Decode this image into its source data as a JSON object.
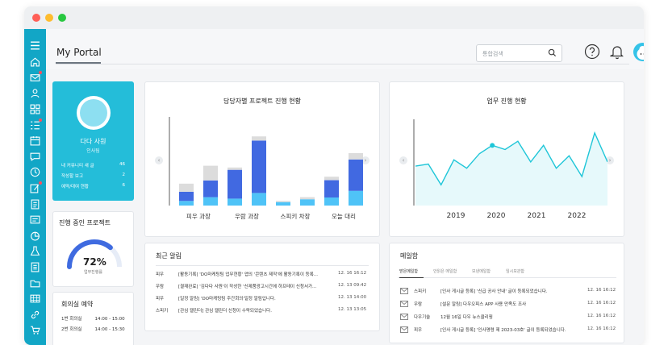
{
  "header": {
    "title": "My Portal",
    "search_placeholder": "통합검색"
  },
  "profile": {
    "name": "다다 사원",
    "role": "인사팀",
    "stats": [
      {
        "label": "내 커뮤니티 새 글",
        "value": "46"
      },
      {
        "label": "작성할 보고",
        "value": "2"
      },
      {
        "label": "예약/대여 현황",
        "value": "6"
      }
    ]
  },
  "project_progress": {
    "title": "진행 중인 프로젝트",
    "percent": "72%",
    "sub": "업무진행률",
    "value": 0.72
  },
  "meeting": {
    "title": "회의실 예약",
    "rows": [
      {
        "room": "1번 회의실",
        "time": "14:00 - 15:00"
      },
      {
        "room": "2번 회의실",
        "time": "14:00 - 15:30"
      }
    ]
  },
  "chart_left": {
    "title": "담당자별 프로젝트 진행 현황"
  },
  "chart_right": {
    "title": "업무 진행 현황"
  },
  "chart_data": [
    {
      "type": "bar",
      "categories": [
        "피우 과장",
        "우람 과장",
        "스피키 차장",
        "오늘 대리"
      ],
      "series": [
        {
          "values": [
            4,
            6,
            3,
            7
          ]
        },
        {
          "values": [
            8,
            25,
            0,
            15
          ]
        },
        {
          "values": [
            7,
            2,
            1,
            3
          ]
        }
      ],
      "bars_per_category": 2,
      "colors": [
        "#4fc3f7",
        "#4169e1",
        "#dcdcdc"
      ]
    },
    {
      "type": "area",
      "x_ticks": [
        "2019",
        "2020",
        "2021",
        "2022"
      ],
      "values": [
        38,
        40,
        20,
        44,
        36,
        50,
        58,
        54,
        62,
        42,
        58,
        36,
        48,
        28,
        70,
        42
      ],
      "color": "#1fc6d8"
    }
  ],
  "alerts": {
    "title": "최근 알림",
    "rows": [
      {
        "who": "피우",
        "text": "[활동기록] 'DO마케팅팀 업무현황' 앱의 '콘텐츠 제작'에 활동기록이 등록...",
        "date": "12. 16 16:12"
      },
      {
        "who": "우람",
        "text": "[결재완료] '김다다 사원'이 작성한 '신제품광고시간에 하프테이 신청서가...",
        "date": "12. 13 09:42"
      },
      {
        "who": "피우",
        "text": "[일정 알림] 'DO마케팅팀 주간회의'일정 알림입니다.",
        "date": "12. 13 14:00"
      },
      {
        "who": "스피키",
        "text": "[관심 캘린더] 관심 캘린더 신청이 수락되었습니다.",
        "date": "12. 13 13:05"
      }
    ]
  },
  "mail": {
    "title": "메일함",
    "tabs": [
      "받은메일함",
      "안읽은 메일함",
      "보낸메일함",
      "임시보관함"
    ],
    "rows": [
      {
        "who": "스피키",
        "text": "[인사 게시글 등록] '신급 공사 안내' 글이 등록되었습니다.",
        "date": "12. 16 16:12"
      },
      {
        "who": "우람",
        "text": "[설문 알림] 다우오피스 APP 사용 만족도 조사",
        "date": "12. 16 16:12"
      },
      {
        "who": "다우기술",
        "text": "12월 16일 다우 뉴스클리핑",
        "date": "12. 16 16:12"
      },
      {
        "who": "피우",
        "text": "[인사 게시글 등록] '인사명령 제 2023-03호' 글이 등록되었습니다.",
        "date": "12. 16 16:12"
      }
    ]
  }
}
